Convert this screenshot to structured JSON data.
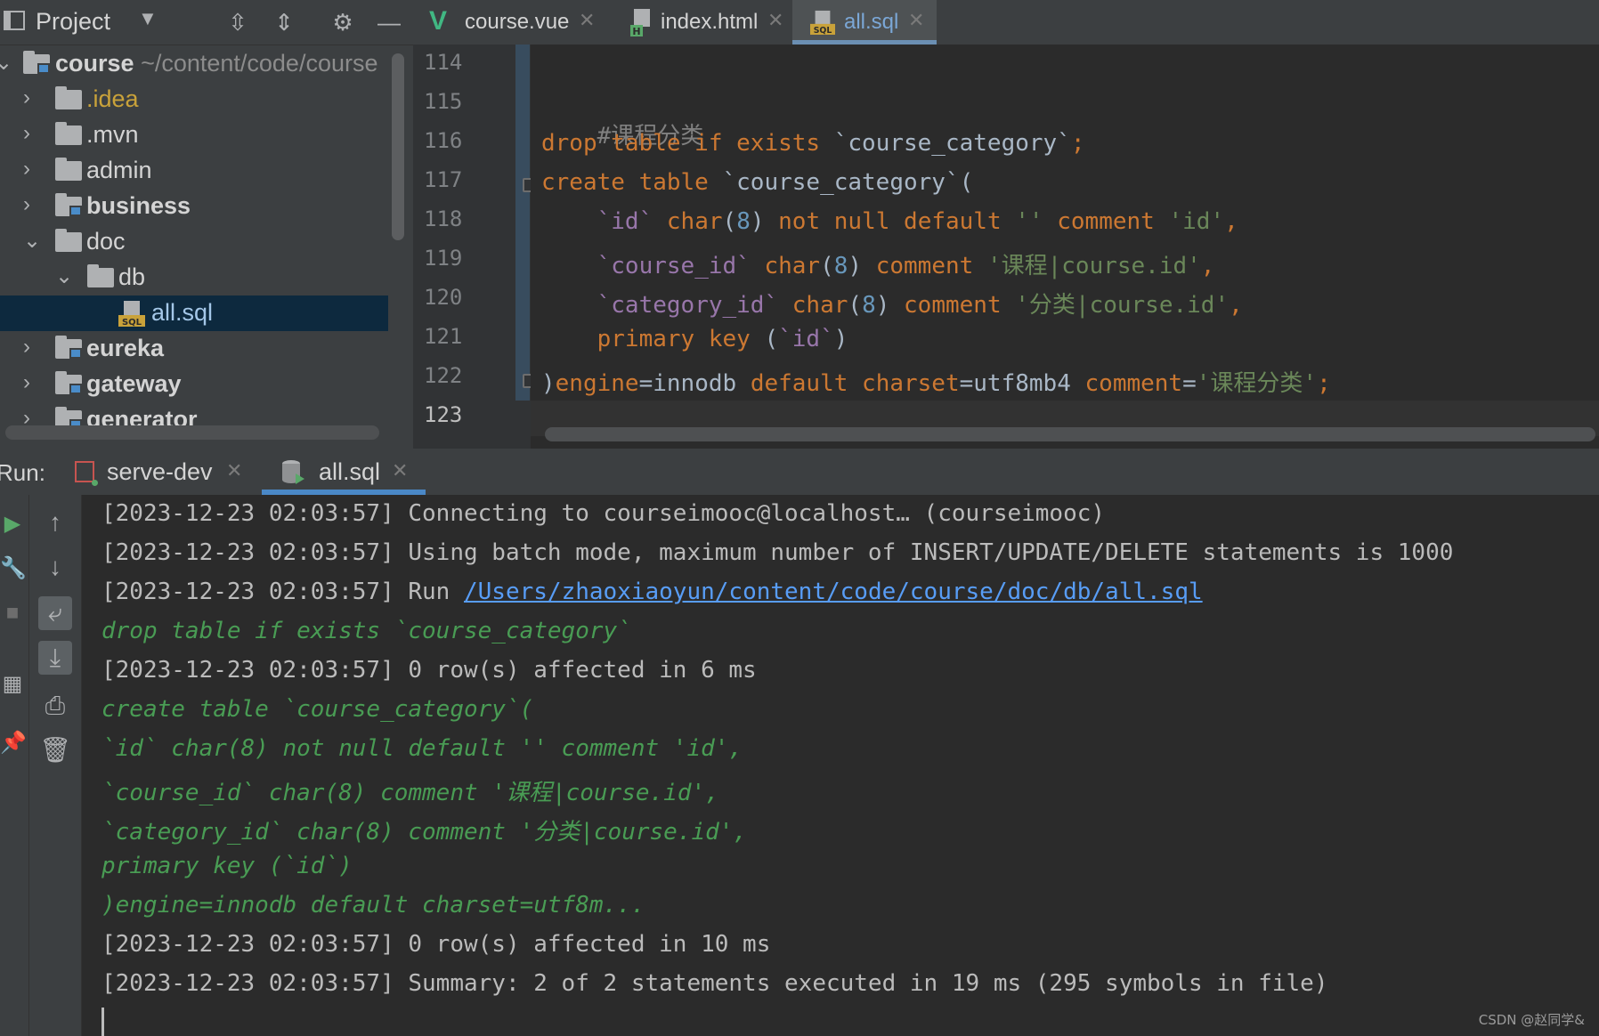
{
  "project_panel": {
    "title": "Project",
    "tree": [
      {
        "label": "course",
        "path": "~/content/code/course",
        "type": "module",
        "expanded": true
      },
      {
        "label": ".idea",
        "type": "folder"
      },
      {
        "label": ".mvn",
        "type": "folder"
      },
      {
        "label": "admin",
        "type": "folder"
      },
      {
        "label": "business",
        "type": "module"
      },
      {
        "label": "doc",
        "type": "folder",
        "expanded": true
      },
      {
        "label": "db",
        "type": "folder",
        "expanded": true
      },
      {
        "label": "all.sql",
        "type": "sql-file",
        "selected": true
      },
      {
        "label": "eureka",
        "type": "module"
      },
      {
        "label": "gateway",
        "type": "module"
      },
      {
        "label": "generator",
        "type": "module"
      }
    ]
  },
  "editor": {
    "tabs": [
      {
        "label": "course.vue",
        "icon": "vue-icon"
      },
      {
        "label": "index.html",
        "icon": "html-file-icon"
      },
      {
        "label": "all.sql",
        "icon": "sql-file-icon",
        "active": true
      }
    ],
    "line_numbers": [
      "114",
      "115",
      "116",
      "117",
      "118",
      "119",
      "120",
      "121",
      "122",
      "123"
    ],
    "code": {
      "l115": "#课程分类",
      "l116": [
        "drop table if exists ",
        "`course_category`",
        ";"
      ],
      "l117": [
        "create table ",
        "`course_category`",
        "("
      ],
      "l118": [
        "    ",
        "`id`",
        " ",
        "char",
        "(",
        "8",
        ") ",
        "not null default ",
        "''",
        " ",
        "comment ",
        "'id'",
        ","
      ],
      "l119": [
        "    ",
        "`course_id`",
        " ",
        "char",
        "(",
        "8",
        ") ",
        "comment ",
        "'课程|course.id'",
        ","
      ],
      "l120": [
        "    ",
        "`category_id`",
        " ",
        "char",
        "(",
        "8",
        ") ",
        "comment ",
        "'分类|course.id'",
        ","
      ],
      "l121": [
        "    ",
        "primary key ",
        "(",
        "`id`",
        ")"
      ],
      "l122": [
        ")",
        "engine",
        "=innodb ",
        "default charset",
        "=utf8mb4 ",
        "comment",
        "=",
        "'课程分类'",
        ";"
      ]
    }
  },
  "run_panel": {
    "label": "Run:",
    "tabs": [
      {
        "label": "serve-dev"
      },
      {
        "label": "all.sql",
        "active": true
      }
    ],
    "console": [
      {
        "kind": "log",
        "text": "[2023-12-23 02:03:57] Connecting to courseimooc@localhost… (courseimooc)"
      },
      {
        "kind": "log",
        "text": "[2023-12-23 02:03:57] Using batch mode, maximum number of INSERT/UPDATE/DELETE statements is 1000"
      },
      {
        "kind": "log",
        "text": "[2023-12-23 02:03:57] Run ",
        "link": "/Users/zhaoxiaoyun/content/code/course/doc/db/all.sql"
      },
      {
        "kind": "sql",
        "text": "drop table if exists `course_category`"
      },
      {
        "kind": "log",
        "text": "[2023-12-23 02:03:57] 0 row(s) affected in 6 ms"
      },
      {
        "kind": "sql",
        "text": "create table `course_category`("
      },
      {
        "kind": "sql",
        "text": "`id` char(8) not null default '' comment 'id',"
      },
      {
        "kind": "sql",
        "text": "`course_id` char(8) comment '课程|course.id',"
      },
      {
        "kind": "sql",
        "text": "`category_id` char(8) comment '分类|course.id',"
      },
      {
        "kind": "sql",
        "text": "primary key (`id`)"
      },
      {
        "kind": "sql",
        "text": ")engine=innodb default charset=utf8m..."
      },
      {
        "kind": "log",
        "text": "[2023-12-23 02:03:57] 0 row(s) affected in 10 ms"
      },
      {
        "kind": "log",
        "text": "[2023-12-23 02:03:57] Summary: 2 of 2 statements executed in 19 ms (295 symbols in file)"
      }
    ],
    "toolbar": [
      "up-arrow-icon",
      "down-arrow-icon",
      "soft-wrap-icon",
      "scroll-to-end-icon",
      "print-icon",
      "trash-icon"
    ]
  },
  "watermark": "CSDN @赵同学&",
  "colors": {
    "keyword": "#cc7832",
    "string": "#6a8759",
    "column": "#9876aa",
    "number": "#6897bb",
    "console_sql": "#499c54",
    "link": "#589df6",
    "selection": "#0d293e"
  }
}
